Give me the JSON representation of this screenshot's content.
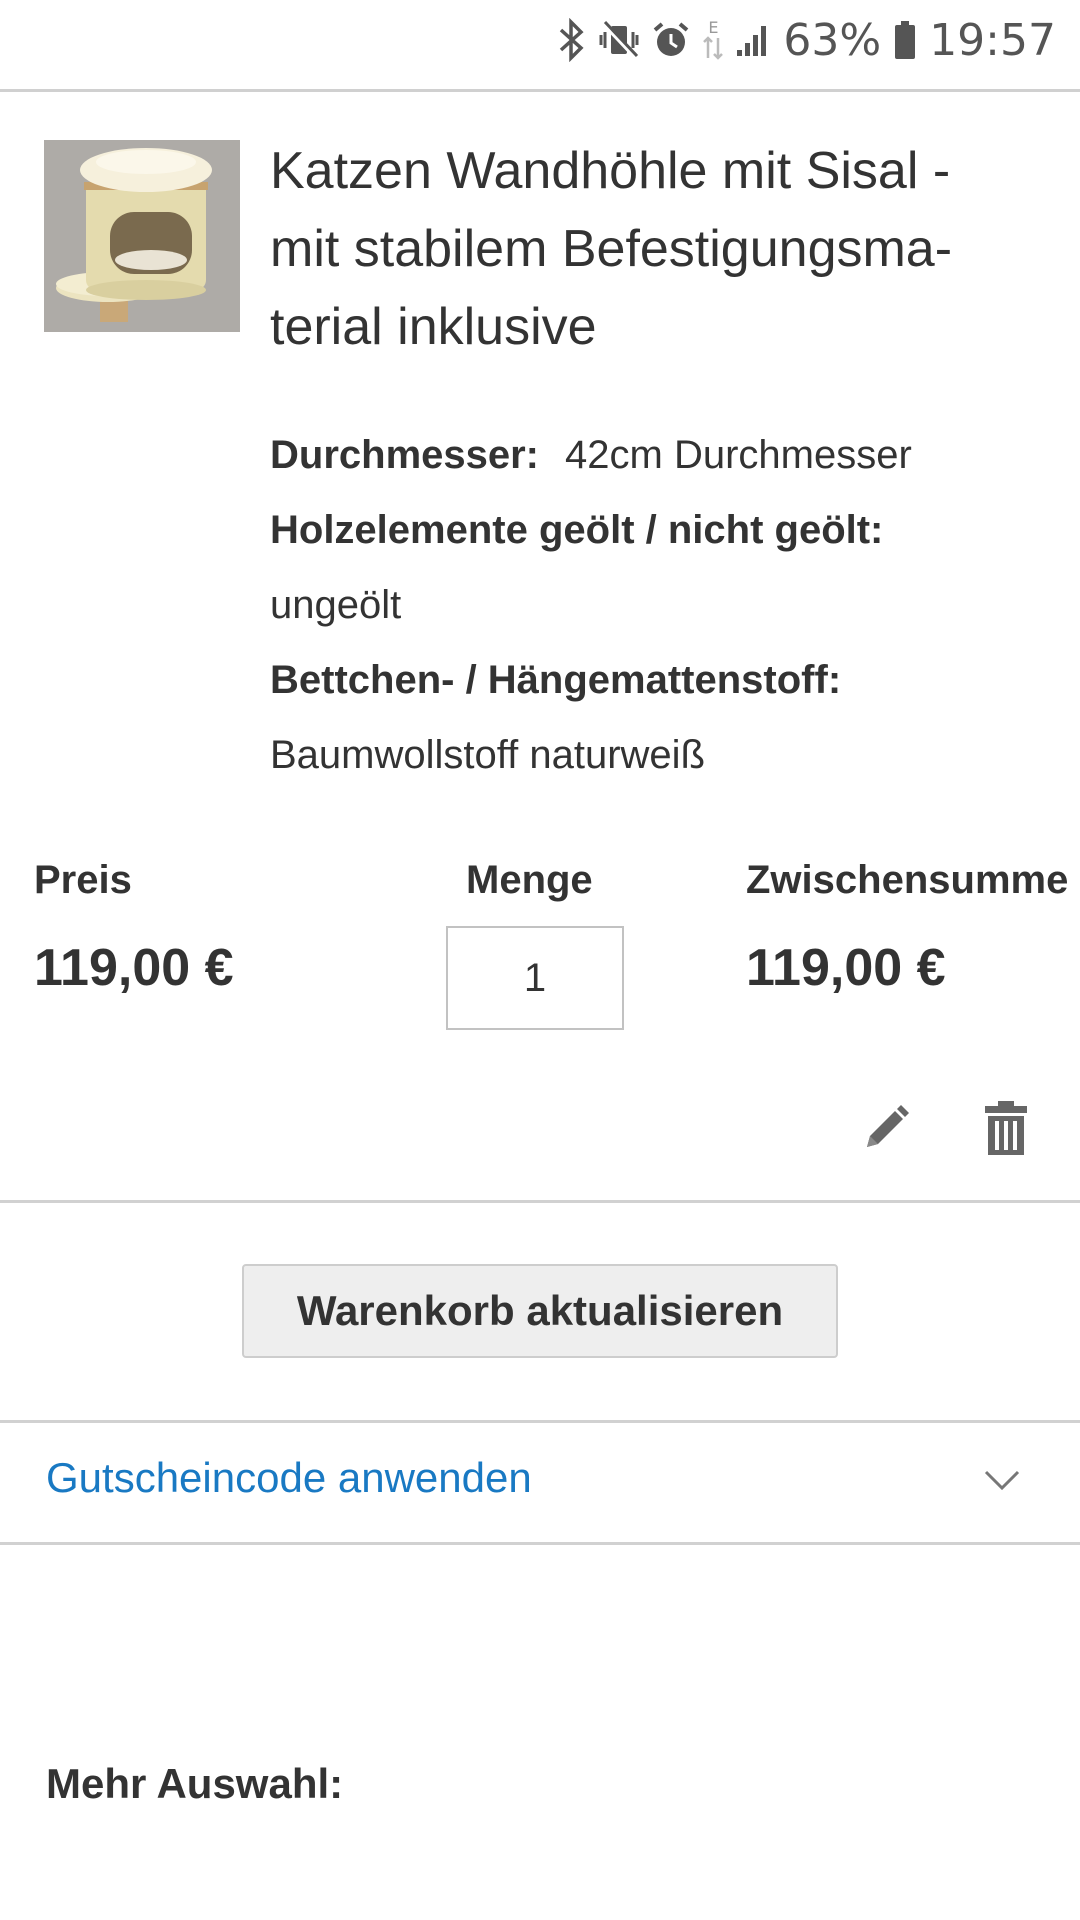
{
  "status_bar": {
    "battery_percent": "63%",
    "time": "19:57",
    "network_type": "E",
    "icons": [
      "bluetooth-icon",
      "vibrate-icon",
      "alarm-icon",
      "data-arrows-icon",
      "signal-icon",
      "battery-icon"
    ]
  },
  "product": {
    "title": "Katzen Wandhöhle mit Sisal - mit stabilem Befestigungsma-terial inklusive",
    "title_lines": [
      "Katzen Wandhöhle mit Sisal -",
      "mit stabilem Befestigungsma-",
      "terial inklusive"
    ],
    "options": [
      {
        "label": "Durchmesser:",
        "value": "42cm Durchmesser"
      },
      {
        "label": "Holzelemente geölt / nicht geölt:",
        "value": "ungeölt"
      },
      {
        "label": "Bettchen- / Hängemattenstoff:",
        "value": "Baumwollstoff naturweiß"
      }
    ]
  },
  "cart_row": {
    "price_label": "Preis",
    "price_value": "119,00 €",
    "qty_label": "Menge",
    "qty_value": "1",
    "subtotal_label": "Zwischensumme",
    "subtotal_value": "119,00 €",
    "edit_icon": "pencil-icon",
    "delete_icon": "trash-icon"
  },
  "update_button": {
    "label": "Warenkorb aktualisieren"
  },
  "coupon": {
    "title": "Gutscheincode anwenden",
    "icon": "chevron-down-icon"
  },
  "more": {
    "title": "Mehr Auswahl:"
  },
  "colors": {
    "text": "#333333",
    "link": "#1979c3",
    "divider": "#d1d1d1",
    "button_bg": "#eeeeee",
    "status_icons": "#555555"
  }
}
